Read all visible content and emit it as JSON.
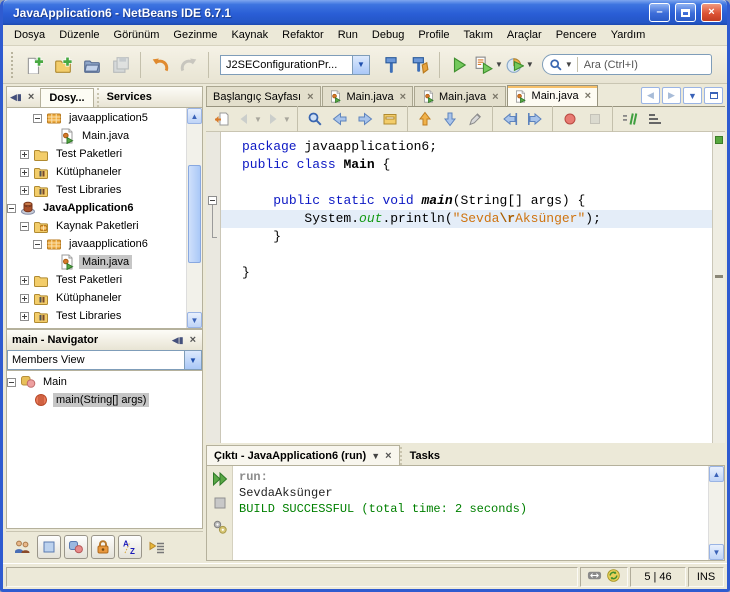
{
  "window": {
    "title": "JavaApplication6 - NetBeans IDE 6.7.1",
    "minimize_glyph": "–",
    "close_glyph": "×"
  },
  "menu": {
    "items": [
      "Dosya",
      "Düzenle",
      "Görünüm",
      "Gezinme",
      "Kaynak",
      "Refaktor",
      "Run",
      "Debug",
      "Profile",
      "Takım",
      "Araçlar",
      "Pencere",
      "Yardım"
    ]
  },
  "toolbar": {
    "file_buttons": [
      {
        "name": "new-file",
        "icon": "new-file-icon"
      },
      {
        "name": "new-project",
        "icon": "new-project-icon"
      },
      {
        "name": "open-project",
        "icon": "open-project-icon"
      },
      {
        "name": "save-all",
        "icon": "save-all-icon",
        "disabled": true
      },
      {
        "sep": true
      },
      {
        "name": "undo",
        "icon": "undo-icon"
      },
      {
        "name": "redo",
        "icon": "redo-icon",
        "disabled": true
      },
      {
        "sep": true
      }
    ],
    "config_combo_value": "J2SEConfigurationPr...",
    "run_buttons": [
      {
        "name": "build",
        "icon": "build-icon"
      },
      {
        "name": "clean-build",
        "icon": "clean-build-icon"
      },
      {
        "sep": true
      },
      {
        "name": "run",
        "icon": "run-icon"
      },
      {
        "name": "debug",
        "icon": "debug-icon",
        "dropdown": true
      },
      {
        "name": "profile",
        "icon": "profile-icon",
        "dropdown": true
      }
    ],
    "search_placeholder": "Ara (Ctrl+I)"
  },
  "projects_panel": {
    "tab_files": "Dosy...",
    "tab_services": "Services",
    "tree": [
      {
        "label": "javaapplication5",
        "icon": "package-icon",
        "indent": 2,
        "expander": "minus"
      },
      {
        "label": "Main.java",
        "icon": "java-file-icon",
        "indent": 3
      },
      {
        "label": "Test Paketleri",
        "icon": "folder-icon",
        "indent": 1,
        "expander": "plus"
      },
      {
        "label": "Kütüphaneler",
        "icon": "libraries-icon",
        "indent": 1,
        "expander": "plus"
      },
      {
        "label": "Test Libraries",
        "icon": "libraries-icon",
        "indent": 1,
        "expander": "plus"
      },
      {
        "label": "JavaApplication6",
        "icon": "project-icon",
        "indent": 0,
        "expander": "minus",
        "bold": true
      },
      {
        "label": "Kaynak Paketleri",
        "icon": "source-folder-icon",
        "indent": 1,
        "expander": "minus"
      },
      {
        "label": "javaapplication6",
        "icon": "package-icon",
        "indent": 2,
        "expander": "minus"
      },
      {
        "label": "Main.java",
        "icon": "java-file-icon",
        "indent": 3,
        "selected": true
      },
      {
        "label": "Test Paketleri",
        "icon": "folder-icon",
        "indent": 1,
        "expander": "plus"
      },
      {
        "label": "Kütüphaneler",
        "icon": "libraries-icon",
        "indent": 1,
        "expander": "plus"
      },
      {
        "label": "Test Libraries",
        "icon": "libraries-icon",
        "indent": 1,
        "expander": "plus"
      }
    ]
  },
  "navigator": {
    "title": "main - Navigator",
    "view": "Members View",
    "tree": [
      {
        "label": "Main",
        "icon": "class-icon",
        "indent": 0,
        "expander": "minus"
      },
      {
        "label": "main(String[] args)",
        "icon": "method-icon",
        "indent": 1,
        "selected": true
      }
    ]
  },
  "editor": {
    "tabs": [
      {
        "label": "Başlangıç Sayfası",
        "close": "×"
      },
      {
        "label": "Main.java",
        "icon": "java-file-icon",
        "close": "×"
      },
      {
        "label": "Main.java",
        "icon": "java-file-icon",
        "close": "×"
      },
      {
        "label": "Main.java",
        "icon": "java-file-icon",
        "close": "×",
        "active": true
      }
    ],
    "toolbar_icons": [
      {
        "name": "last-edit",
        "icon": "last-edit-icon"
      },
      {
        "name": "back",
        "icon": "back-icon",
        "disabled": true,
        "dropdown": true
      },
      {
        "name": "forward",
        "icon": "forward-icon",
        "disabled": true,
        "dropdown": true
      },
      {
        "sep": true
      },
      {
        "name": "find-selection",
        "icon": "find-selection-icon"
      },
      {
        "name": "find-previous",
        "icon": "find-prev-icon"
      },
      {
        "name": "find-next",
        "icon": "find-next-icon"
      },
      {
        "name": "toggle-highlight",
        "icon": "toggle-highlight-icon"
      },
      {
        "sep": true
      },
      {
        "name": "previous-occurrence",
        "icon": "prev-occurrence-icon"
      },
      {
        "name": "next-occurrence",
        "icon": "next-occurrence-icon"
      },
      {
        "name": "rename",
        "icon": "rename-icon"
      },
      {
        "sep": true
      },
      {
        "name": "shift-left",
        "icon": "shift-left-icon"
      },
      {
        "name": "shift-right",
        "icon": "shift-right-icon"
      },
      {
        "sep": true
      },
      {
        "name": "record-macro",
        "icon": "record-macro-icon"
      },
      {
        "name": "stop-macro",
        "icon": "stop-macro-icon",
        "disabled": true
      },
      {
        "sep": true
      },
      {
        "name": "comment",
        "icon": "comment-icon"
      },
      {
        "name": "uncomment",
        "icon": "uncomment-icon"
      }
    ],
    "code": {
      "lines": [
        [
          [
            "kw",
            "package"
          ],
          [
            "pl",
            " javaapplication6;"
          ]
        ],
        [
          [
            "kw",
            "public"
          ],
          [
            "pl",
            " "
          ],
          [
            "kw",
            "class"
          ],
          [
            "pl",
            " "
          ],
          [
            "cls",
            "Main"
          ],
          [
            "pl",
            " {"
          ]
        ],
        [],
        [
          [
            "pl",
            "    "
          ],
          [
            "kw",
            "public"
          ],
          [
            "pl",
            " "
          ],
          [
            "kw",
            "static"
          ],
          [
            "pl",
            " "
          ],
          [
            "kw",
            "void"
          ],
          [
            "pl",
            " "
          ],
          [
            "mtd",
            "main"
          ],
          [
            "pl",
            "(String[] args) {"
          ]
        ],
        [
          [
            "pl",
            "        System."
          ],
          [
            "fld",
            "out"
          ],
          [
            "pl",
            ".println("
          ],
          [
            "str",
            "\"Sevda"
          ],
          [
            "strb",
            "\\r"
          ],
          [
            "str",
            "Aksünger\""
          ],
          [
            "pl",
            ");"
          ]
        ],
        [
          [
            "pl",
            "    }"
          ]
        ],
        [],
        [
          [
            "pl",
            "}"
          ]
        ]
      ],
      "highlight_line": 4,
      "fold_start": 3,
      "fold_end": 5
    }
  },
  "output": {
    "tab_output": "Çıktı - JavaApplication6 (run)",
    "tab_tasks": "Tasks",
    "strip_icons": [
      {
        "name": "rerun",
        "icon": "rerun-icon"
      },
      {
        "name": "stop-run",
        "icon": "stop-output-icon",
        "disabled": true
      },
      {
        "name": "ant-settings",
        "icon": "ant-settings-icon"
      }
    ],
    "lines": [
      {
        "text": "run:",
        "cls": "o-meta"
      },
      {
        "text": "SevdaAksünger",
        "cls": "o-stdout"
      },
      {
        "text": "BUILD SUCCESSFUL (total time: 2 seconds)",
        "cls": "o-success"
      }
    ]
  },
  "bottom_toolbar": {
    "icons": [
      {
        "name": "team",
        "icon": "team-icon",
        "plain": true
      },
      {
        "name": "editor-pane",
        "icon": "editor-pane-icon"
      },
      {
        "name": "show-members",
        "icon": "shapes-icon"
      },
      {
        "name": "lock",
        "icon": "lock-icon"
      },
      {
        "name": "sort-alphabetically",
        "icon": "sort-alpha-icon"
      },
      {
        "name": "apply-filters",
        "icon": "filter-icon",
        "plain": true
      }
    ]
  },
  "statusbar": {
    "icons": [
      {
        "name": "typing-mode",
        "icon": "typing-mode-icon"
      },
      {
        "name": "file-sync",
        "icon": "file-sync-icon"
      }
    ],
    "position": "5 | 46",
    "mode": "INS"
  }
}
